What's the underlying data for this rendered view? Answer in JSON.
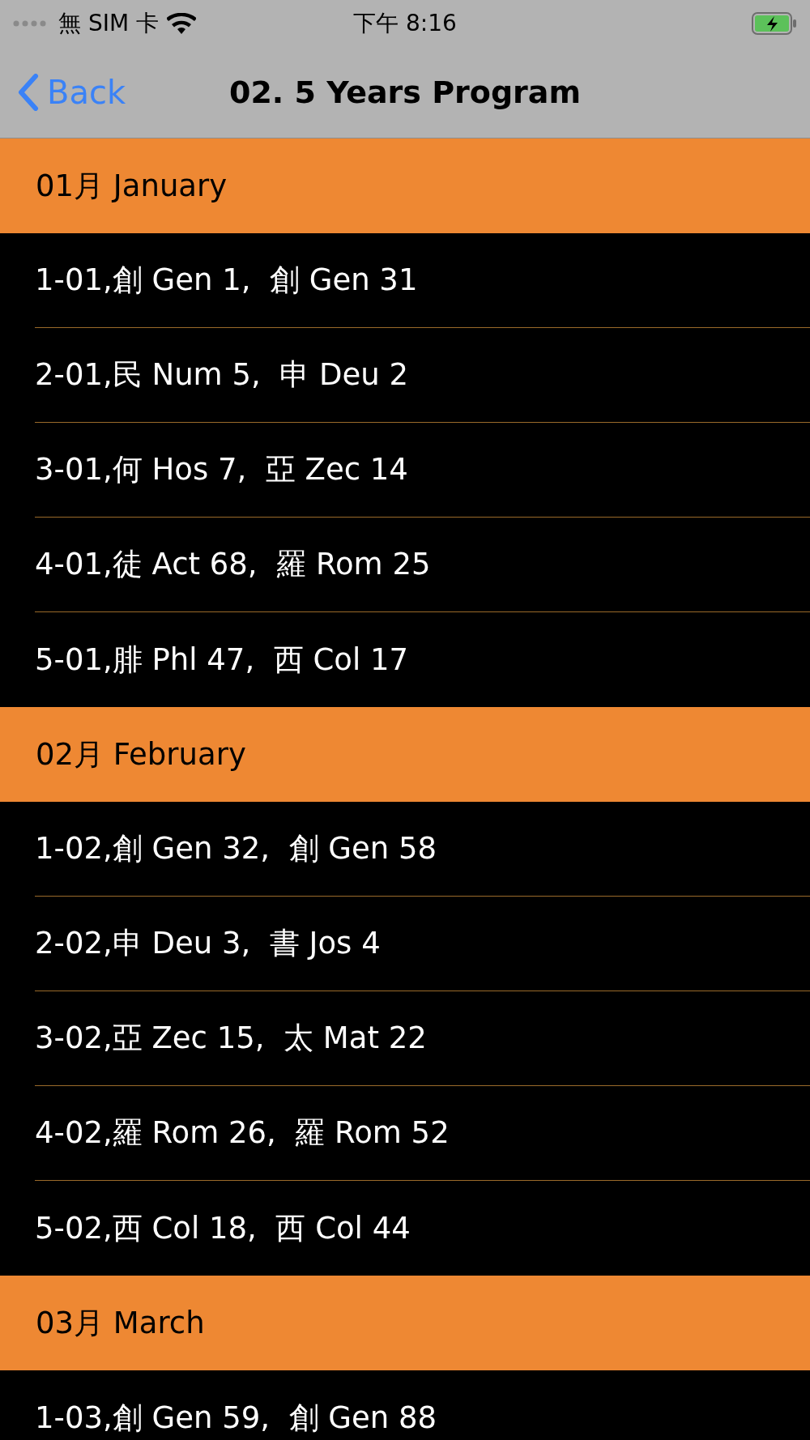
{
  "status_bar": {
    "carrier": "無 SIM 卡",
    "time": "下午 8:16"
  },
  "navigation_bar": {
    "back": "Back",
    "title": "02. 5 Years Program"
  },
  "sections": [
    {
      "title": "01月 January",
      "rows": [
        "1-01,創 Gen 1,  創 Gen 31",
        "2-01,民 Num 5,  申 Deu 2",
        "3-01,何 Hos 7,  亞 Zec 14",
        "4-01,徒 Act 68,  羅 Rom 25",
        "5-01,腓 Phl 47,  西 Col 17"
      ]
    },
    {
      "title": "02月 February",
      "rows": [
        "1-02,創 Gen 32,  創 Gen 58",
        "2-02,申 Deu 3,  書 Jos 4",
        "3-02,亞 Zec 15,  太 Mat 22",
        "4-02,羅 Rom 26,  羅 Rom 52",
        "5-02,西 Col 18,  西 Col 44"
      ]
    },
    {
      "title": "03月 March",
      "rows": [
        "1-03,創 Gen 59,  創 Gen 88"
      ]
    }
  ]
}
